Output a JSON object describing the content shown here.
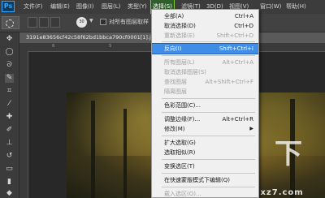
{
  "app": {
    "logo": "Ps"
  },
  "menubar": {
    "items": [
      {
        "label": "文件(F)"
      },
      {
        "label": "编辑(E)"
      },
      {
        "label": "图像(I)"
      },
      {
        "label": "图层(L)"
      },
      {
        "label": "类型(Y)"
      },
      {
        "label": "选择(S)"
      },
      {
        "label": "滤镜(T)"
      },
      {
        "label": "3D(D)"
      },
      {
        "label": "视图(V)"
      },
      {
        "label": "窗口(W)"
      },
      {
        "label": "帮助(H)"
      }
    ]
  },
  "options": {
    "brush_size": "30",
    "sample_all_layers_label": "对所有图层取样"
  },
  "document": {
    "tab_title": "3191e83656cf42c58f62bd1bbca790cf0001[1].jp"
  },
  "rulers": {
    "h_numbers": [
      "6",
      "5"
    ]
  },
  "watermark": {
    "glyph": "下",
    "text": "下载集 xz7.com"
  },
  "select_menu": {
    "items": [
      {
        "label": "全部(A)",
        "shortcut": "Ctrl+A",
        "disabled": false
      },
      {
        "label": "取消选择(D)",
        "shortcut": "Ctrl+D",
        "disabled": false
      },
      {
        "label": "重新选择(E)",
        "shortcut": "Shift+Ctrl+D",
        "disabled": true
      },
      {
        "label": "反向(I)",
        "shortcut": "Shift+Ctrl+I",
        "disabled": false,
        "highlighted": true
      },
      {
        "label": "所有图层(L)",
        "shortcut": "Alt+Ctrl+A",
        "disabled": true
      },
      {
        "label": "取消选择图层(S)",
        "shortcut": "",
        "disabled": true
      },
      {
        "label": "查找图层",
        "shortcut": "Alt+Shift+Ctrl+F",
        "disabled": true
      },
      {
        "label": "隔离图层",
        "shortcut": "",
        "disabled": true
      },
      {
        "label": "色彩范围(C)...",
        "shortcut": "",
        "disabled": false
      },
      {
        "label": "调整边缘(F)...",
        "shortcut": "Alt+Ctrl+R",
        "disabled": false
      },
      {
        "label": "修改(M)",
        "shortcut": "",
        "disabled": false,
        "submenu": true
      },
      {
        "label": "扩大选取(G)",
        "shortcut": "",
        "disabled": false
      },
      {
        "label": "选取相似(R)",
        "shortcut": "",
        "disabled": false
      },
      {
        "label": "变换选区(T)",
        "shortcut": "",
        "disabled": false
      },
      {
        "label": "在快速蒙版模式下编辑(Q)",
        "shortcut": "",
        "disabled": false
      },
      {
        "label": "载入选区(O)...",
        "shortcut": "",
        "disabled": true
      }
    ]
  }
}
